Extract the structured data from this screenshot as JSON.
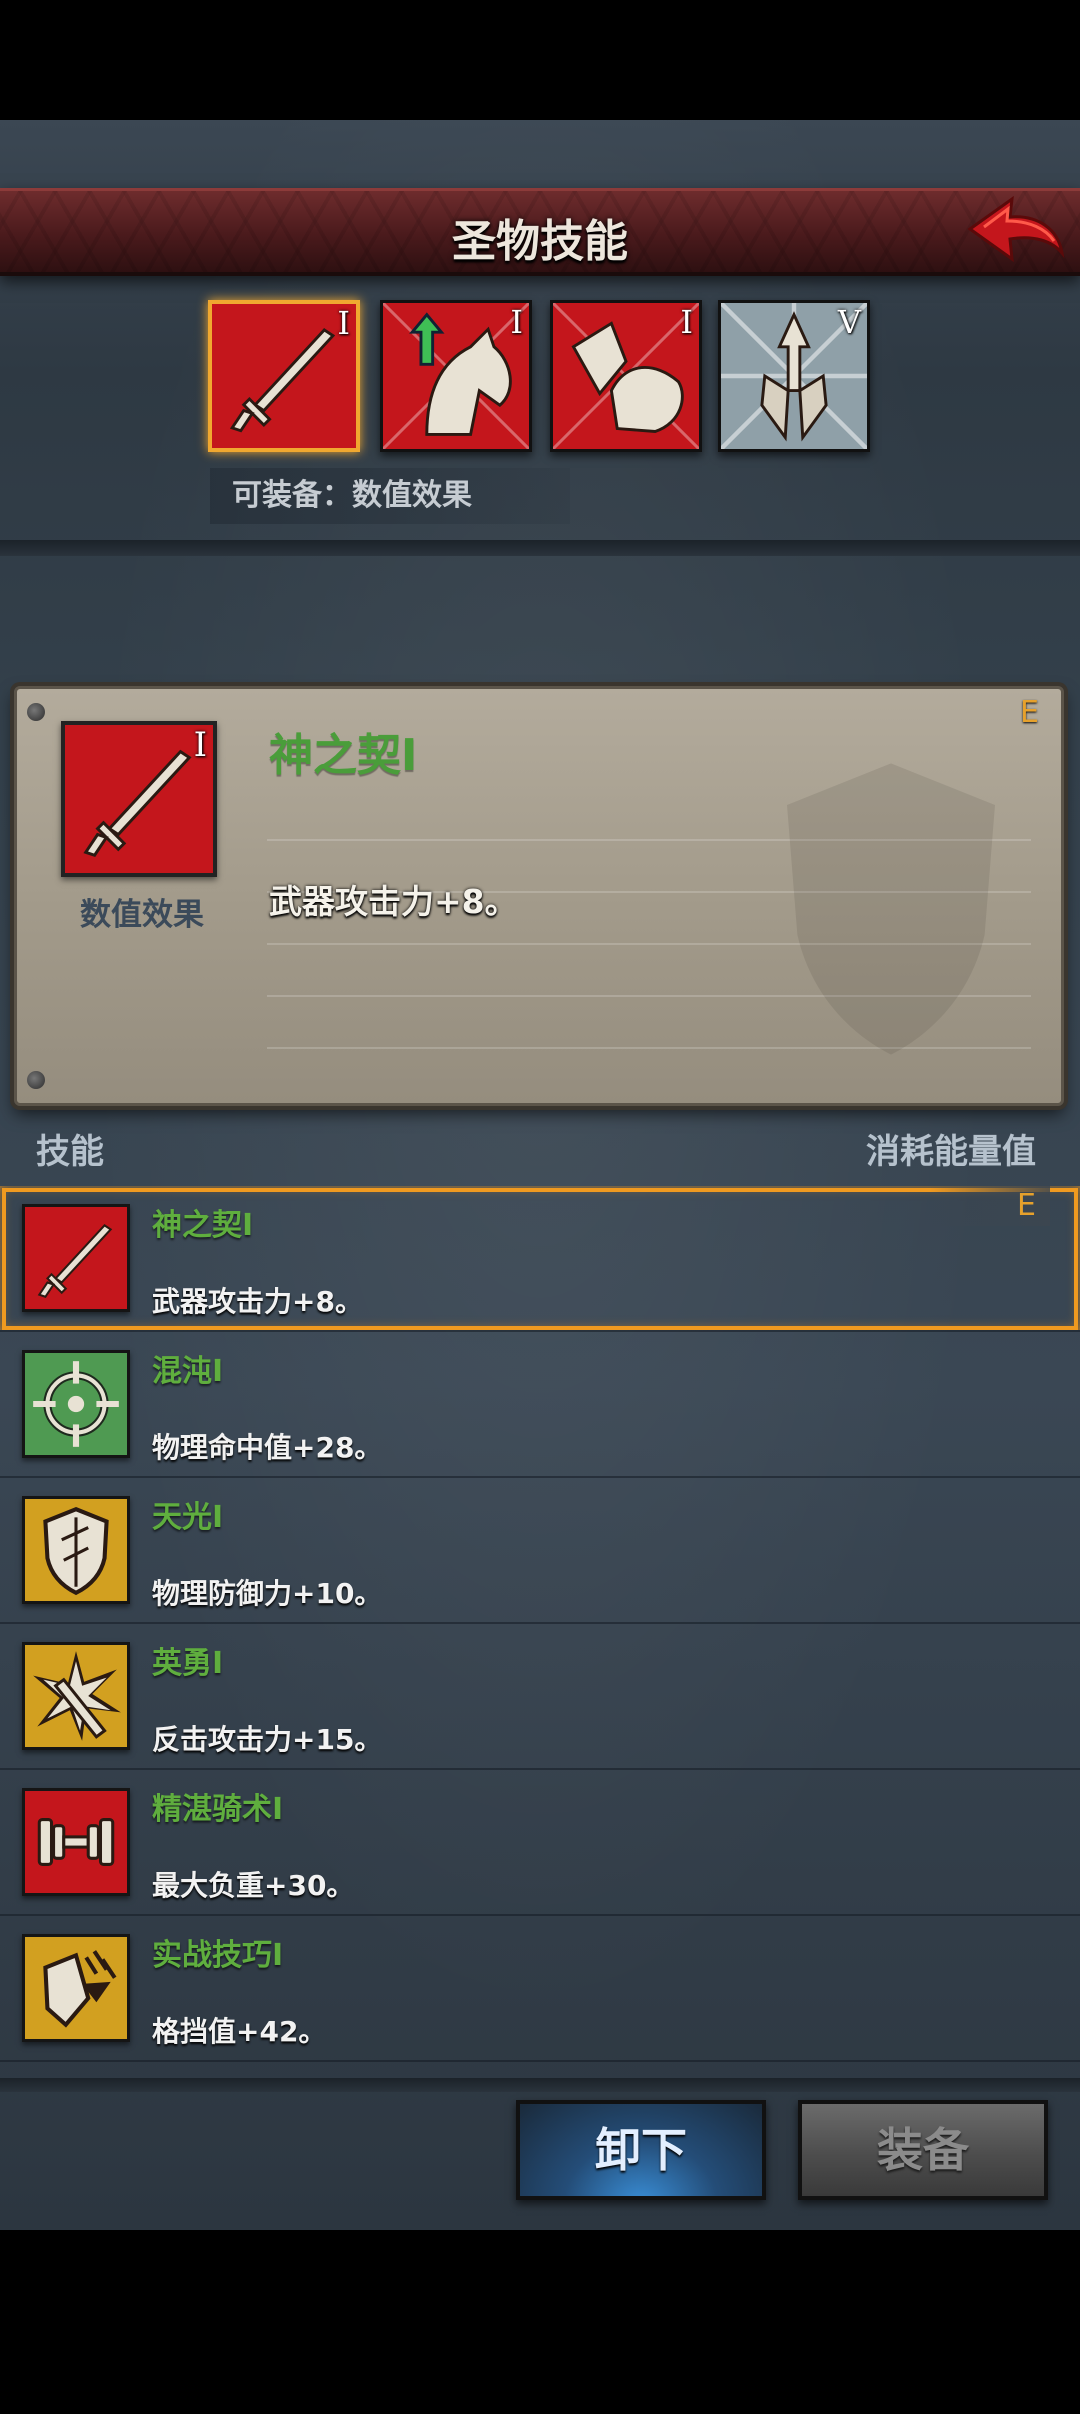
{
  "header": {
    "title": "圣物技能"
  },
  "relics": [
    {
      "icon": "sword-icon",
      "rank": "I",
      "bg": "#c4161c",
      "selected": true
    },
    {
      "icon": "horse-upgrade-icon",
      "rank": "I",
      "bg": "#c4161c",
      "selected": false
    },
    {
      "icon": "horse-armor-icon",
      "rank": "I",
      "bg": "#c4161c",
      "selected": false
    },
    {
      "icon": "spear-icon",
      "rank": "V",
      "bg": "#8fa0a8",
      "selected": false
    }
  ],
  "equip_hint": "可装备：数值效果",
  "detail": {
    "name": "神之契I",
    "type": "数值效果",
    "description": "武器攻击力+8。",
    "grade": "E",
    "icon_rank": "I"
  },
  "list_header": {
    "left": "技能",
    "right": "消耗能量值"
  },
  "skills": [
    {
      "icon": "sword-icon",
      "name": "神之契I",
      "desc": "武器攻击力+8。",
      "grade": "E",
      "bg": "#c4161c",
      "selected": true
    },
    {
      "icon": "crosshair-icon",
      "name": "混沌I",
      "desc": "物理命中值+28。",
      "bg": "#4f9a52"
    },
    {
      "icon": "shield-icon",
      "name": "天光I",
      "desc": "物理防御力+10。",
      "bg": "#d2a020"
    },
    {
      "icon": "burst-arrow-icon",
      "name": "英勇I",
      "desc": "反击攻击力+15。",
      "bg": "#d2a020"
    },
    {
      "icon": "dumbbell-icon",
      "name": "精湛骑术I",
      "desc": "最大负重+30。",
      "bg": "#c4161c"
    },
    {
      "icon": "block-icon",
      "name": "实战技巧I",
      "desc": "格挡值+42。",
      "bg": "#d2a020"
    }
  ],
  "buttons": {
    "unequip": "卸下",
    "equip": "装备"
  }
}
